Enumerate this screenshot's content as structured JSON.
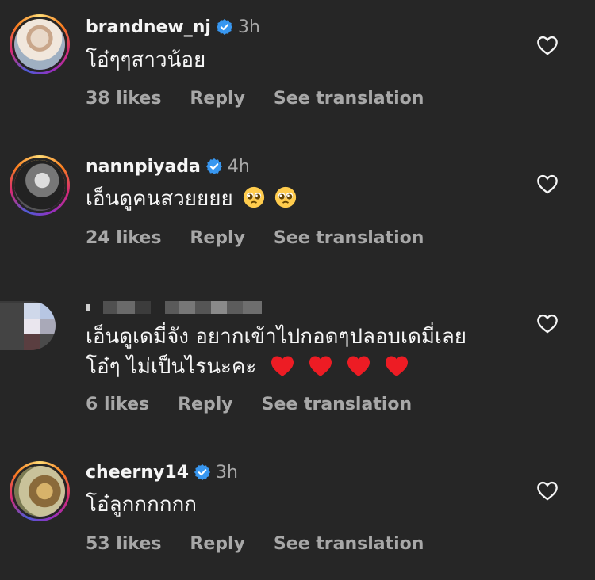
{
  "comments": [
    {
      "username": "brandnew_nj",
      "verified": true,
      "time": "3h",
      "text": "โอ๋ๆๆสาวน้อย",
      "likes": "38 likes",
      "reply": "Reply",
      "translate": "See translation",
      "avatar": "profile-photo"
    },
    {
      "username": "nannpiyada",
      "verified": true,
      "time": "4h",
      "text": "เอ็นดูคนสวยยยย",
      "emojis": [
        "pleading-face-emoji",
        "pleading-face-emoji"
      ],
      "likes": "24 likes",
      "reply": "Reply",
      "translate": "See translation",
      "avatar": "profile-photo"
    },
    {
      "username": "",
      "verified": false,
      "time": "",
      "text_line1": "เอ็นดูเดมี่จัง อยากเข้าไปกอดๆปลอบเดมี่เลย",
      "text_line2": "โอ๋ๆ ไม่เป็นไรนะคะ",
      "emojis": [
        "red-heart-emoji",
        "red-heart-emoji",
        "red-heart-emoji",
        "red-heart-emoji"
      ],
      "likes": "6 likes",
      "reply": "Reply",
      "translate": "See translation",
      "avatar": "pixelated-photo"
    },
    {
      "username": "cheerny14",
      "verified": true,
      "time": "3h",
      "text": "โอ๋ลูกกกกกก",
      "likes": "53 likes",
      "reply": "Reply",
      "translate": "See translation",
      "avatar": "profile-photo"
    }
  ],
  "colors": {
    "background": "#262626",
    "primary_text": "#f5f5f5",
    "secondary_text": "#a8a8a8",
    "verified_blue": "#3897f0",
    "heart_red": "#ed1c24"
  },
  "icons": [
    "verified-badge-icon",
    "heart-outline-icon"
  ]
}
